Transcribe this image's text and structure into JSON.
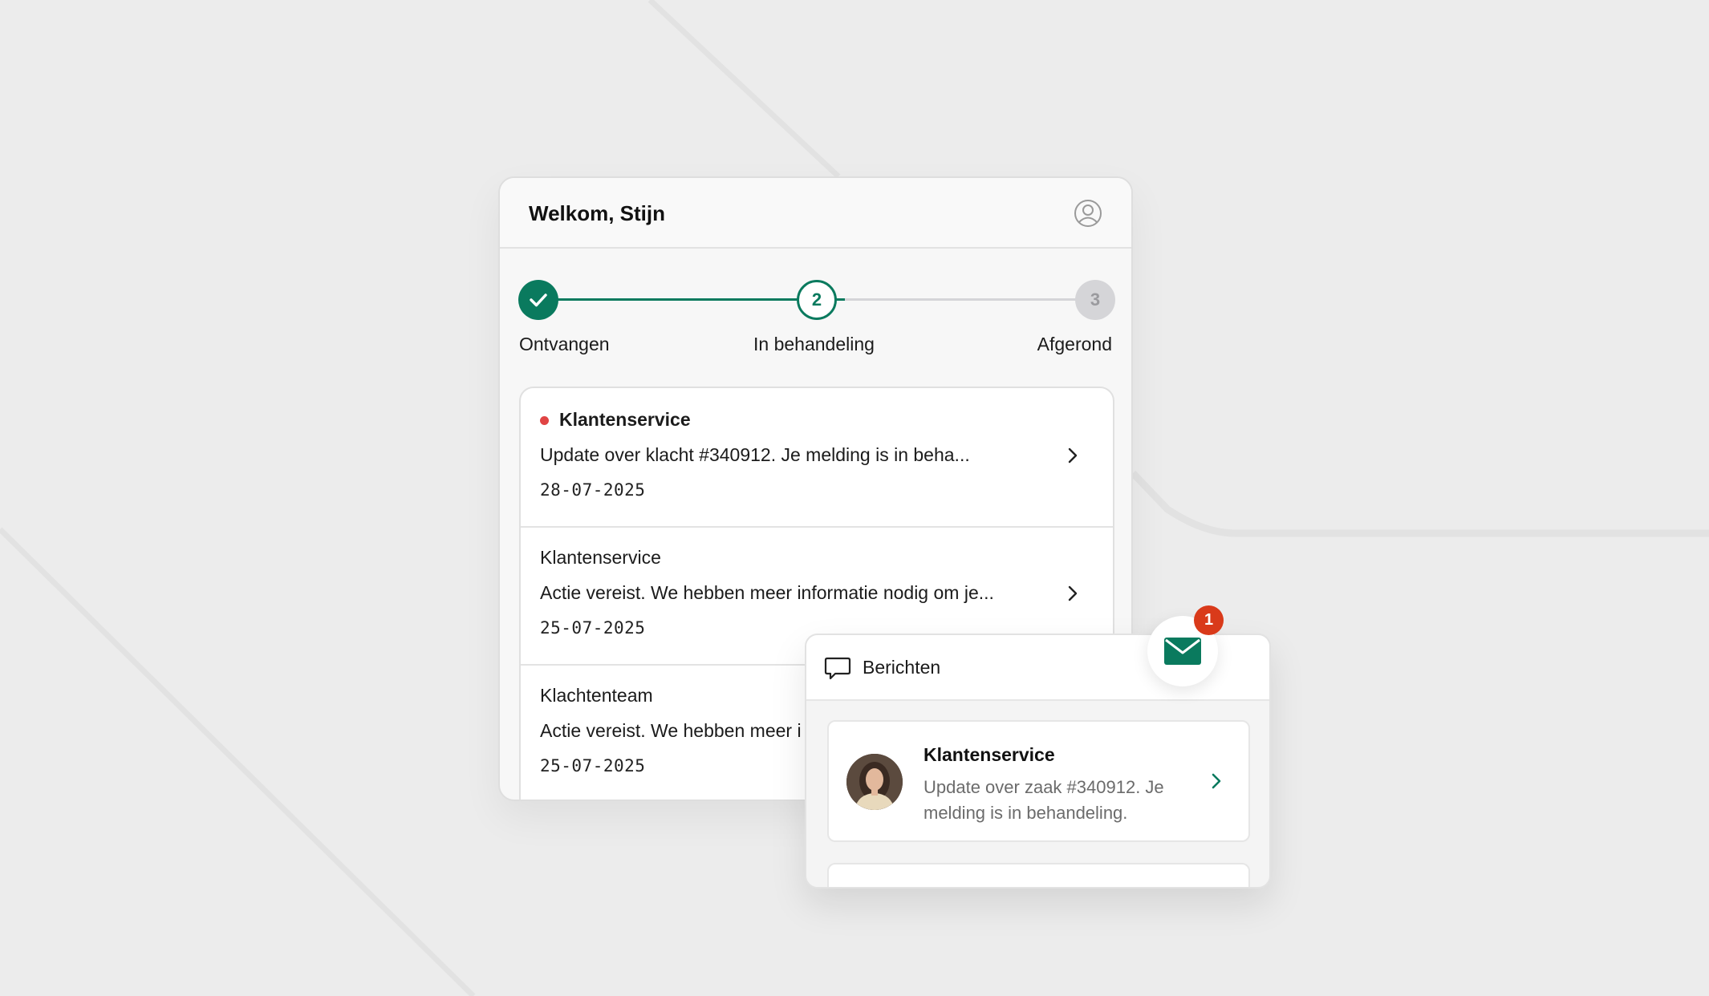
{
  "header": {
    "greeting": "Welkom, Stijn",
    "account_icon": "user-circle-icon"
  },
  "stepper": {
    "steps": [
      {
        "label": "Ontvangen",
        "number": "1",
        "state": "done"
      },
      {
        "label": "In behandeling",
        "number": "2",
        "state": "active"
      },
      {
        "label": "Afgerond",
        "number": "3",
        "state": "pending"
      }
    ]
  },
  "updates": [
    {
      "sender": "Klantenservice",
      "unread": true,
      "text": "Update over klacht #340912. Je melding is in beha...",
      "date": "28-07-2025"
    },
    {
      "sender": "Klantenservice",
      "unread": false,
      "text": "Actie vereist. We hebben meer informatie nodig om je...",
      "date": "25-07-2025"
    },
    {
      "sender": "Klachtenteam",
      "unread": false,
      "text": "Actie vereist. We hebben meer i",
      "date": "25-07-2025"
    }
  ],
  "messages": {
    "title": "Berichten",
    "badge_count": "1",
    "items": [
      {
        "sender": "Klantenservice",
        "text": "Update over zaak #340912. Je melding is in behandeling."
      }
    ]
  },
  "colors": {
    "accent": "#0a7a5e",
    "unread_dot": "#e04444",
    "badge": "#d93a1a",
    "pending": "#d5d5d8"
  }
}
